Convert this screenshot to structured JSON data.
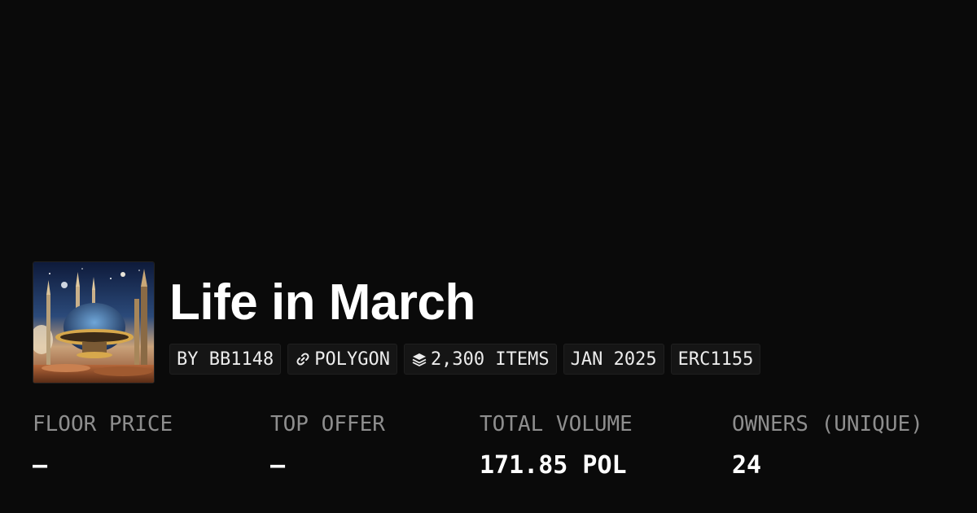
{
  "collection": {
    "title": "Life in March",
    "image_alt": "Futuristic domed city artwork",
    "tags": [
      {
        "label": "BY BB1148",
        "icon": ""
      },
      {
        "label": "POLYGON",
        "icon": "link-icon"
      },
      {
        "label": "2,300 ITEMS",
        "icon": "layers-icon"
      },
      {
        "label": "JAN 2025",
        "icon": ""
      },
      {
        "label": "ERC1155",
        "icon": ""
      }
    ]
  },
  "stats": [
    {
      "label": "FLOOR PRICE",
      "value": "—"
    },
    {
      "label": "TOP OFFER",
      "value": "—"
    },
    {
      "label": "TOTAL VOLUME",
      "value": "171.85 POL"
    },
    {
      "label": "OWNERS (UNIQUE)",
      "value": "24"
    }
  ],
  "colors": {
    "background": "#0a0a0a",
    "tag_background": "#151515",
    "label_gray": "#8e8e8e",
    "text": "#ffffff"
  }
}
